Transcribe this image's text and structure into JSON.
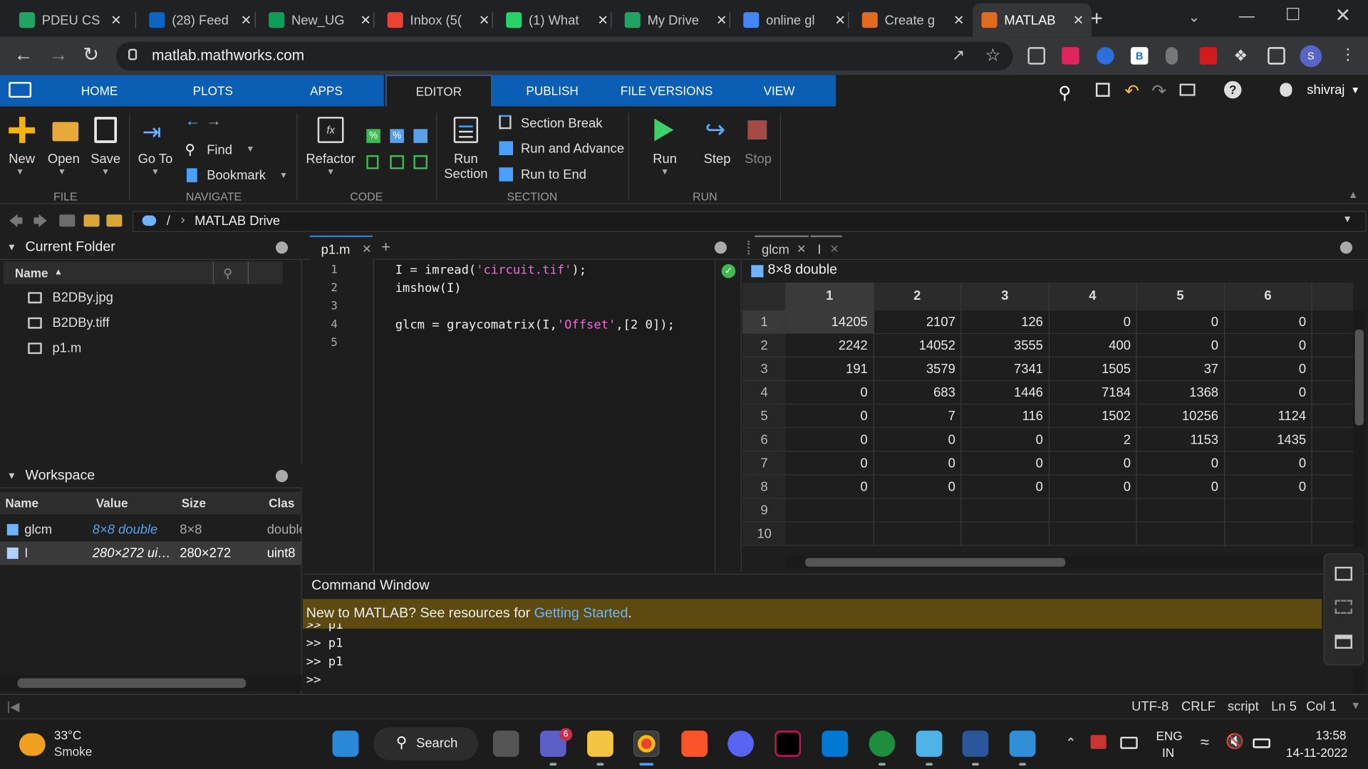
{
  "browser": {
    "tabs": [
      {
        "label": "PDEU CS",
        "icon": "google-drive-icon",
        "color": "#1fa463"
      },
      {
        "label": "(28) Feed",
        "icon": "linkedin-icon",
        "color": "#0a66c2"
      },
      {
        "label": "New_UG",
        "icon": "sheet-icon",
        "color": "#0f9d58"
      },
      {
        "label": "Inbox (5(",
        "icon": "gmail-icon",
        "color": "#ea4335"
      },
      {
        "label": "(1) What",
        "icon": "whatsapp-icon",
        "color": "#25d366"
      },
      {
        "label": "My Drive",
        "icon": "google-drive-icon",
        "color": "#1fa463"
      },
      {
        "label": "online gl",
        "icon": "google-icon",
        "color": "#4285f4"
      },
      {
        "label": "Create g",
        "icon": "matlab-icon",
        "color": "#e06b1f"
      },
      {
        "label": "MATLAB",
        "icon": "matlab-icon",
        "color": "#e06b1f",
        "active": true
      }
    ],
    "url": "matlab.mathworks.com",
    "profile_initial": "S",
    "extension_b": "B"
  },
  "ribbon": {
    "tabs": [
      "HOME",
      "PLOTS",
      "APPS",
      "EDITOR",
      "PUBLISH",
      "FILE VERSIONS",
      "VIEW"
    ],
    "user": "shivraj",
    "file": {
      "new": "New",
      "open": "Open",
      "save": "Save",
      "group": "FILE"
    },
    "navigate": {
      "goto": "Go To",
      "find": "Find",
      "bookmark": "Bookmark",
      "group": "NAVIGATE"
    },
    "code": {
      "refactor": "Refactor",
      "group": "CODE"
    },
    "section": {
      "run_section_1": "Run",
      "run_section_2": "Section",
      "section_break": "Section Break",
      "run_advance": "Run and Advance",
      "run_end": "Run to End",
      "group": "SECTION"
    },
    "run": {
      "run": "Run",
      "step": "Step",
      "stop": "Stop",
      "group": "RUN"
    }
  },
  "path": {
    "root": "/",
    "current": "MATLAB Drive"
  },
  "current_folder": {
    "title": "Current Folder",
    "col_name": "Name",
    "files": [
      "B2DBy.jpg",
      "B2DBy.tiff",
      "p1.m"
    ]
  },
  "workspace": {
    "title": "Workspace",
    "cols": [
      "Name",
      "Value",
      "Size",
      "Clas"
    ],
    "vars": [
      {
        "name": "glcm",
        "value": "8×8 double",
        "size": "8×8",
        "class": "double"
      },
      {
        "name": "I",
        "value": "280×272 ui…",
        "size": "280×272",
        "class": "uint8"
      }
    ]
  },
  "editor": {
    "tab": "p1.m",
    "line_numbers": [
      "1",
      "2",
      "3",
      "4",
      "5"
    ]
  },
  "variables": {
    "tabs": [
      "glcm",
      "I"
    ],
    "title": "8×8 double",
    "col_headers": [
      "1",
      "2",
      "3",
      "4",
      "5",
      "6"
    ],
    "row_headers": [
      "1",
      "2",
      "3",
      "4",
      "5",
      "6",
      "7",
      "8",
      "9",
      "10"
    ],
    "cells": [
      [
        "14205",
        "2107",
        "126",
        "0",
        "0",
        "0"
      ],
      [
        "2242",
        "14052",
        "3555",
        "400",
        "0",
        "0"
      ],
      [
        "191",
        "3579",
        "7341",
        "1505",
        "37",
        "0"
      ],
      [
        "0",
        "683",
        "1446",
        "7184",
        "1368",
        "0"
      ],
      [
        "0",
        "7",
        "116",
        "1502",
        "10256",
        "1124"
      ],
      [
        "0",
        "0",
        "0",
        "2",
        "1153",
        "1435"
      ],
      [
        "0",
        "0",
        "0",
        "0",
        "0",
        "0"
      ],
      [
        "0",
        "0",
        "0",
        "0",
        "0",
        "0"
      ],
      [
        "",
        "",
        "",
        "",
        "",
        ""
      ],
      [
        "",
        "",
        "",
        "",
        "",
        ""
      ]
    ]
  },
  "command_window": {
    "title": "Command Window",
    "banner_text": "New to MATLAB? See resources for ",
    "banner_link": "Getting Started",
    "banner_end": ".",
    "lines": [
      ">> p1",
      ">> p1",
      ">> p1",
      ">>"
    ]
  },
  "status_bar": {
    "encoding": "UTF-8",
    "eol": "CRLF",
    "type": "script",
    "ln": "Ln 5",
    "col": "Col 1"
  },
  "taskbar": {
    "temp": "33°C",
    "weather": "Smoke",
    "search": "Search",
    "teams_badge": "6",
    "lang1": "ENG",
    "lang2": "IN",
    "time": "13:58",
    "date": "14-11-2022"
  }
}
